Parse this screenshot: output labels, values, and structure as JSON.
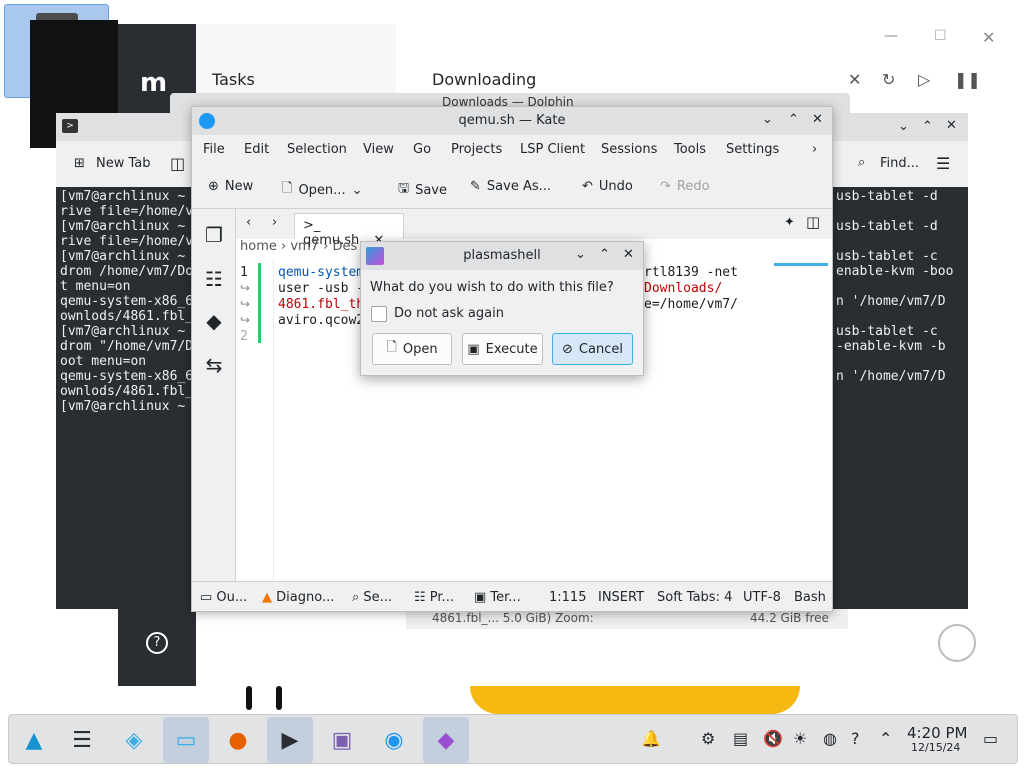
{
  "desktop": {
    "icon_label": "qemu.sh"
  },
  "background_app": {
    "tasks_title": "Tasks",
    "downloading_title": "Downloading",
    "status_text": "4861.fbl_... 5.0 GiB)   Zoom:",
    "free_space": "44.2 GiB free"
  },
  "dolphin": {
    "title": "Downloads — Dolphin"
  },
  "terminal_left": {
    "new_tab": "New Tab",
    "lines": "[vm7@archlinux ~\nrive file=/home/v\n[vm7@archlinux ~\nrive file=/home/v\n[vm7@archlinux ~\ndrom /home/vm7/Do\nt menu=on\nqemu-system-x86_6\nownlods/4861.fbl_\n[vm7@archlinux ~\ndrom \"/home/vm7/D\noot menu=on\nqemu-system-x86_6\nownlods/4861.fbl_\n[vm7@archlinux ~"
  },
  "terminal_right": {
    "find": "Find...",
    "lines": "usb-tablet -d\n\nusb-tablet -d\n\nusb-tablet -c\nenable-kvm -boo\n\nn '/home/vm7/D\n\nusb-tablet -c\n-enable-kvm -b\n\nn '/home/vm7/D"
  },
  "kate": {
    "title": "qemu.sh — Kate",
    "menu": [
      "File",
      "Edit",
      "Selection",
      "View",
      "Go",
      "Projects",
      "LSP Client",
      "Sessions",
      "Tools",
      "Settings"
    ],
    "toolbar": {
      "new": "New",
      "open": "Open...",
      "save": "Save",
      "save_as": "Save As...",
      "undo": "Undo",
      "redo": "Redo"
    },
    "tab": "qemu.sh",
    "breadcrumb": {
      "p1": "home",
      "p2": "vm7",
      "p3": "Des"
    },
    "line_numbers": [
      "1",
      "2"
    ],
    "code": {
      "l1a": "qemu-system",
      "l1b": "rtl8139 -net",
      "l2a": "user -usb -",
      "l2b": "Downloads/",
      "l3a": "4861.fbl_th",
      "l3b": "e=/home/vm7/",
      "l4a": "aviro.qcow2"
    },
    "status": {
      "output": "Ou...",
      "diagnostics": "Diagno...",
      "search": "Se...",
      "projects": "Pr...",
      "terminal": "Ter...",
      "cursor": "1:115",
      "mode": "INSERT",
      "tabs": "Soft Tabs: 4",
      "encoding": "UTF-8",
      "language": "Bash"
    }
  },
  "dialog": {
    "title": "plasmashell",
    "question": "What do you wish to do with this file?",
    "checkbox": "Do not ask again",
    "open": "Open",
    "execute": "Execute",
    "cancel": "Cancel"
  },
  "taskbar": {
    "time": "4:20 PM",
    "date": "12/15/24"
  }
}
